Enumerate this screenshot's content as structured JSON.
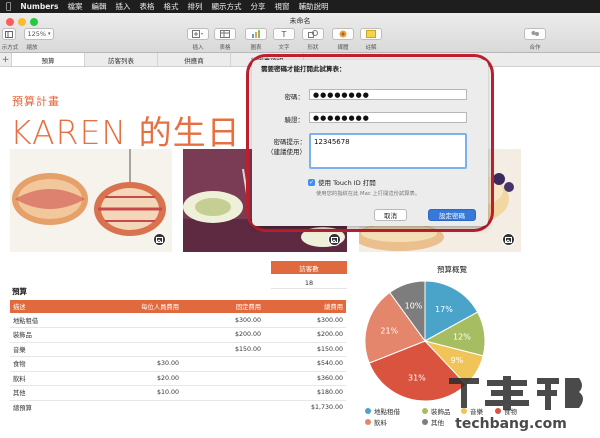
{
  "menubar": {
    "app_name": "Numbers",
    "items": [
      "檔案",
      "編輯",
      "插入",
      "表格",
      "格式",
      "排列",
      "顯示方式",
      "分享",
      "視窗",
      "輔助說明"
    ]
  },
  "window": {
    "title": "未命名",
    "zoom": "125%"
  },
  "toolbar": {
    "left_labels": [
      "示方式",
      "縮放"
    ],
    "buttons": [
      {
        "label": "插入",
        "icon": "insert-icon"
      },
      {
        "label": "表格",
        "icon": "table-icon"
      },
      {
        "label": "圖表",
        "icon": "chart-icon"
      },
      {
        "label": "文字",
        "icon": "text-icon"
      },
      {
        "label": "形狀",
        "icon": "shape-icon"
      },
      {
        "label": "媒體",
        "icon": "media-icon"
      },
      {
        "label": "註解",
        "icon": "comment-icon"
      },
      {
        "label": "合作",
        "icon": "collaborate-icon"
      }
    ]
  },
  "tabs": [
    "預算",
    "訪客列表",
    "供應商",
    "待辦事項切"
  ],
  "document": {
    "subtitle": "預算計畫",
    "title": "KAREN 的生日"
  },
  "guests": {
    "header": "訪客數",
    "value": "18"
  },
  "budget_table": {
    "title": "預算",
    "headers": [
      "描述",
      "每位人員費用",
      "固定費用",
      "總費用"
    ],
    "rows": [
      [
        "地點租借",
        "",
        "$300.00",
        "$300.00"
      ],
      [
        "裝飾品",
        "",
        "$200.00",
        "$200.00"
      ],
      [
        "音樂",
        "",
        "$150.00",
        "$150.00"
      ],
      [
        "食物",
        "$30.00",
        "",
        "$540.00"
      ],
      [
        "飲料",
        "$20.00",
        "",
        "$360.00"
      ],
      [
        "其他",
        "$10.00",
        "",
        "$180.00"
      ]
    ],
    "total_label": "總預算",
    "total_value": "$1,730.00"
  },
  "chart_data": {
    "type": "pie",
    "title": "預算概覽",
    "categories": [
      "地點租借",
      "裝飾品",
      "音樂",
      "食物",
      "飲料",
      "其他"
    ],
    "values": [
      17,
      12,
      9,
      31,
      21,
      10
    ],
    "labels": [
      "17%",
      "12%",
      "9%",
      "31%",
      "21%",
      "10%"
    ],
    "colors": [
      "#4aa3c9",
      "#a7bd62",
      "#f1c45a",
      "#d9533f",
      "#e4866b",
      "#7d7d7d"
    ],
    "legend_position": "bottom"
  },
  "modal": {
    "title": "需要密碼才能打開此試算表：",
    "password_label": "密碼：",
    "password_value": "●●●●●●●●",
    "verify_label": "驗證：",
    "verify_value": "●●●●●●●●",
    "hint_label_1": "密碼提示：",
    "hint_label_2": "（建議使用）",
    "hint_value": "12345678",
    "touchid_label": "使用 Touch ID 打開",
    "touchid_checked": true,
    "note": "使用您的指紋在此 Mac 上打開這份試算表。",
    "cancel_label": "取消",
    "ok_label": "設定密碼"
  },
  "watermark": {
    "text_top": "T客邦",
    "text_bottom": "techbang.com"
  }
}
